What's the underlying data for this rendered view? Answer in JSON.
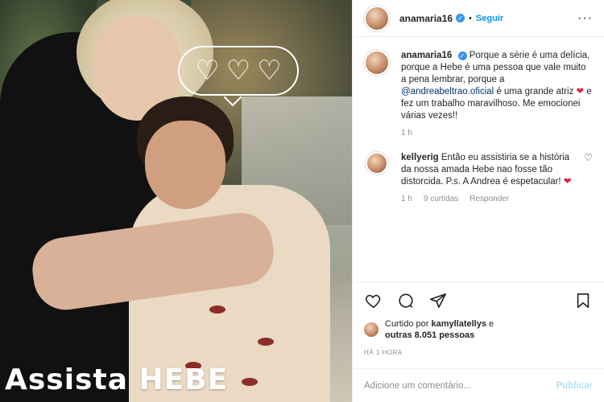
{
  "post": {
    "overlay_text": "Assista HEBE",
    "bubble_hearts": [
      "♡",
      "♡",
      "♡"
    ]
  },
  "header": {
    "username": "anamaria16",
    "verified": "✓",
    "separator": "•",
    "follow_label": "Seguir",
    "more_label": "···"
  },
  "caption": {
    "username": "anamaria16",
    "text_part1": "Porque a série é uma delícia, porque a Hebe é uma pessoa que vale muito a pena lembrar, porque a ",
    "mention": "@andreabeltrao.oficial",
    "text_part2": " é uma grande atriz ",
    "heart": "❤",
    "text_part3": " e fez um trabalho maravilhoso. Me emocionei várias vezes!!",
    "time": "1 h"
  },
  "comment": {
    "username": "kellyerig",
    "text": "Então eu assistiria se a história da nossa amada Hebe nao fosse tão distorcida. P.s. A Andrea é espetacular! ",
    "heart": "❤",
    "time": "1 h",
    "likes": "9 curtidas",
    "reply": "Responder",
    "like_icon": "♡"
  },
  "likes": {
    "prefix": "Curtido por ",
    "user": "kamyllatellys",
    "middle": " e",
    "others": "outras 8.051 pessoas"
  },
  "timestamp": "HÁ 1 HORA",
  "add_comment": {
    "placeholder": "Adicione um comentário...",
    "publish": "Publicar"
  },
  "colors": {
    "accent": "#0095f6",
    "verified": "#3897f0",
    "heart": "#e0263a",
    "mention": "#00376b"
  },
  "icons": [
    "heart-icon",
    "comment-icon",
    "share-icon",
    "bookmark-icon",
    "more-icon",
    "verified-icon"
  ]
}
